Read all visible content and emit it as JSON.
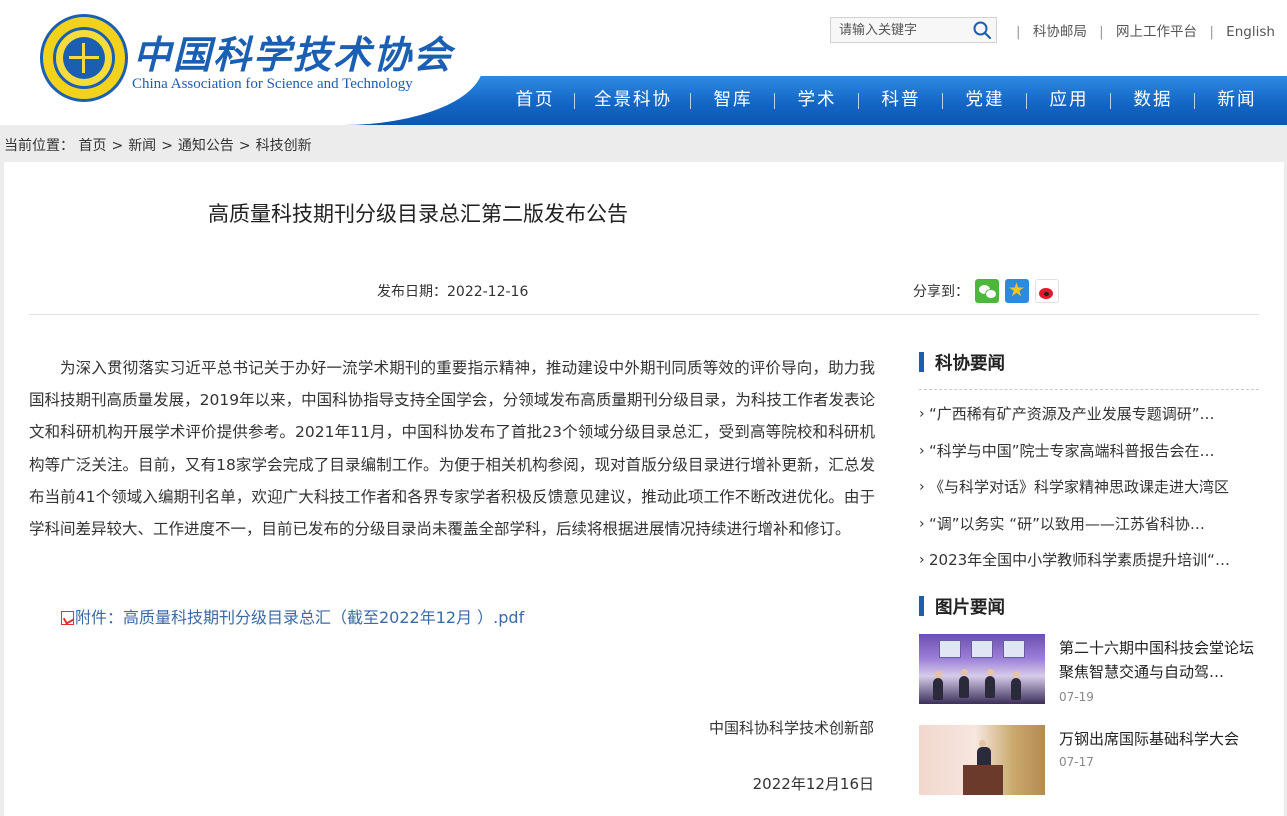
{
  "header": {
    "logo_cn": "中国科学技术协会",
    "logo_en": "China Association for Science and Technology",
    "search_placeholder": "请输入关键字",
    "top_links": [
      "科协邮局",
      "网上工作平台",
      "English"
    ],
    "nav": [
      "首页",
      "全景科协",
      "智库",
      "学术",
      "科普",
      "党建",
      "应用",
      "数据",
      "新闻"
    ]
  },
  "breadcrumb": {
    "label": "当前位置：",
    "items": [
      "首页",
      "新闻",
      "通知公告",
      "科技创新"
    ],
    "separator": ">"
  },
  "article": {
    "title": "高质量科技期刊分级目录总汇第二版发布公告",
    "date_label": "发布日期：2022-12-16",
    "share_label": "分享到：",
    "share_icons": [
      "wechat-icon",
      "qzone-icon",
      "weibo-icon"
    ],
    "body": "为深入贯彻落实习近平总书记关于办好一流学术期刊的重要指示精神，推动建设中外期刊同质等效的评价导向，助力我国科技期刊高质量发展，2019年以来，中国科协指导支持全国学会，分领域发布高质量期刊分级目录，为科技工作者发表论文和科研机构开展学术评价提供参考。2021年11月，中国科协发布了首批23个领域分级目录总汇，受到高等院校和科研机构等广泛关注。目前，又有18家学会完成了目录编制工作。为便于相关机构参阅，现对首版分级目录进行增补更新，汇总发布当前41个领域入编期刊名单，欢迎广大科技工作者和各界专家学者积极反馈意见建议，推动此项工作不断改进优化。由于学科间差异较大、工作进度不一，目前已发布的分级目录尚未覆盖全部学科，后续将根据进展情况持续进行增补和修订。",
    "attachment": "附件：高质量科技期刊分级目录总汇（截至2022年12月 ）.pdf",
    "signature_org": "中国科协科学技术创新部",
    "signature_date": "2022年12月16日"
  },
  "sidebar": {
    "news_heading": "科协要闻",
    "news": [
      "“广西稀有矿产资源及产业发展专题调研”…",
      "“科学与中国”院士专家高端科普报告会在…",
      "《与科学对话》科学家精神思政课走进大湾区",
      "“调”以务实 “研”以致用——江苏省科协…",
      "2023年全国中小学教师科学素质提升培训“…"
    ],
    "pic_heading": "图片要闻",
    "pics": [
      {
        "title": "第二十六期中国科技会堂论坛聚焦智慧交通与自动驾…",
        "date": "07-19"
      },
      {
        "title": "万钢出席国际基础科学大会",
        "date": "07-17"
      }
    ]
  }
}
